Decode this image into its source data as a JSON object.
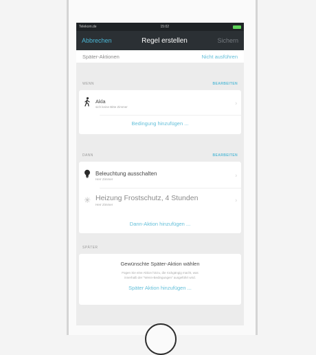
{
  "statusbar": {
    "carrier": "Telekom.de",
    "time": "15:02"
  },
  "navbar": {
    "cancel_label": "Abbrechen",
    "title": "Regel erstellen",
    "save_label": "Sichern"
  },
  "later_actions": {
    "label": "Später-Aktionen",
    "value": "Nicht ausführen"
  },
  "when_section": {
    "header": "WENN",
    "edit_label": "BEARBEITEN",
    "items": [
      {
        "title": "Akla",
        "subtitle": "sich keine Bitte Zimmer"
      }
    ],
    "add_label": "Bedingung hinzufügen ..."
  },
  "then_section": {
    "header": "DANN",
    "edit_label": "BEARBEITEN",
    "items": [
      {
        "title": "Beleuchtung ausschalten",
        "subtitle": "Herr Zimmer"
      },
      {
        "title": "Heizung Frostschutz, 4 Stunden",
        "subtitle": "Herr Zimmer"
      }
    ],
    "add_label": "Dann-Aktion hinzufügen ..."
  },
  "later_section": {
    "header": "SPÄTER",
    "title": "Gewünschte Später-Aktion wählen",
    "description_line1": "Fügen Sie eine Aktion hinzu, die rückgängig macht, was",
    "description_line2": "innerhalb der \"Wenn-Bedingungen\" ausgeführt wird.",
    "add_label": "Später Aktion hinzufügen ..."
  },
  "colors": {
    "accent": "#4bb7d6",
    "navbar_bg": "#2b3034",
    "screen_bg": "#ececec"
  }
}
